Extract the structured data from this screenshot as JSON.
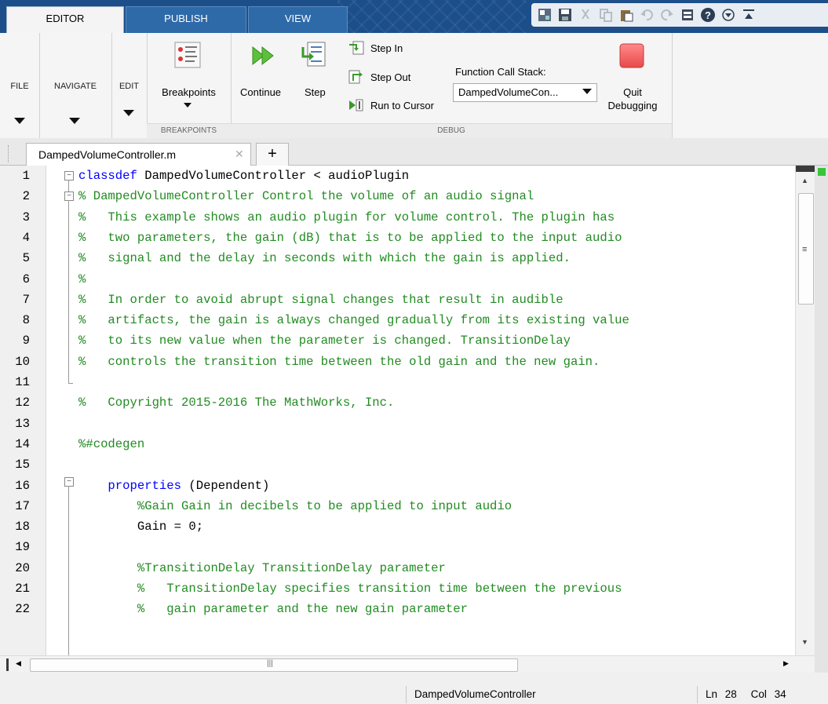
{
  "tabs": [
    {
      "label": "EDITOR",
      "active": true
    },
    {
      "label": "PUBLISH",
      "active": false
    },
    {
      "label": "VIEW",
      "active": false
    }
  ],
  "quick_access": [
    "layout-icon",
    "save-icon",
    "cut-icon",
    "copy-icon",
    "paste-icon",
    "undo-icon",
    "redo-icon",
    "switch-windows-icon",
    "help-icon",
    "expand-icon",
    "minimize-ribbon-icon"
  ],
  "ribbon": {
    "file": {
      "label": "FILE"
    },
    "navigate": {
      "label": "NAVIGATE"
    },
    "edit": {
      "label": "EDIT"
    },
    "breakpoints": {
      "button": "Breakpoints",
      "section": "BREAKPOINTS"
    },
    "debug": {
      "continue": "Continue",
      "step": "Step",
      "step_in": "Step In",
      "step_out": "Step Out",
      "run_to_cursor": "Run to Cursor",
      "stack_label": "Function Call Stack:",
      "stack_value": "DampedVolumeCon...",
      "quit_line1": "Quit",
      "quit_line2": "Debugging",
      "section": "DEBUG"
    }
  },
  "document": {
    "tab_name": "DampedVolumeController.m",
    "new_tab": "+"
  },
  "code_lines": [
    {
      "n": "1",
      "kw": "classdef",
      "text": " DampedVolumeController < audioPlugin",
      "cm": ""
    },
    {
      "n": "2",
      "kw": "",
      "text": "",
      "cm": "% DampedVolumeController Control the volume of an audio signal"
    },
    {
      "n": "3",
      "kw": "",
      "text": "",
      "cm": "%   This example shows an audio plugin for volume control. The plugin has"
    },
    {
      "n": "4",
      "kw": "",
      "text": "",
      "cm": "%   two parameters, the gain (dB) that is to be applied to the input audio"
    },
    {
      "n": "5",
      "kw": "",
      "text": "",
      "cm": "%   signal and the delay in seconds with which the gain is applied."
    },
    {
      "n": "6",
      "kw": "",
      "text": "",
      "cm": "%"
    },
    {
      "n": "7",
      "kw": "",
      "text": "",
      "cm": "%   In order to avoid abrupt signal changes that result in audible"
    },
    {
      "n": "8",
      "kw": "",
      "text": "",
      "cm": "%   artifacts, the gain is always changed gradually from its existing value"
    },
    {
      "n": "9",
      "kw": "",
      "text": "",
      "cm": "%   to its new value when the parameter is changed. TransitionDelay"
    },
    {
      "n": "10",
      "kw": "",
      "text": "",
      "cm": "%   controls the transition time between the old gain and the new gain."
    },
    {
      "n": "11",
      "kw": "",
      "text": "",
      "cm": ""
    },
    {
      "n": "12",
      "kw": "",
      "text": "",
      "cm": "%   Copyright 2015-2016 The MathWorks, Inc."
    },
    {
      "n": "13",
      "kw": "",
      "text": "",
      "cm": ""
    },
    {
      "n": "14",
      "kw": "",
      "text": "",
      "cm": "%#codegen"
    },
    {
      "n": "15",
      "kw": "",
      "text": "",
      "cm": ""
    },
    {
      "n": "16",
      "kw": "    properties",
      "text": " (Dependent)",
      "cm": ""
    },
    {
      "n": "17",
      "kw": "",
      "text": "        ",
      "cm": "%Gain Gain in decibels to be applied to input audio"
    },
    {
      "n": "18",
      "kw": "",
      "text": "        Gain = 0;",
      "cm": ""
    },
    {
      "n": "19",
      "kw": "",
      "text": "",
      "cm": ""
    },
    {
      "n": "20",
      "kw": "",
      "text": "        ",
      "cm": "%TransitionDelay TransitionDelay parameter"
    },
    {
      "n": "21",
      "kw": "",
      "text": "        ",
      "cm": "%   TransitionDelay specifies transition time between the previous"
    },
    {
      "n": "22",
      "kw": "",
      "text": "        ",
      "cm": "%   gain parameter and the new gain parameter"
    }
  ],
  "status": {
    "function_name": "DampedVolumeController",
    "ln_label": "Ln",
    "ln_value": "28",
    "col_label": "Col",
    "col_value": "34"
  },
  "colors": {
    "keyword": "#0000ff",
    "comment": "#228b22",
    "tabstrip": "#1c4f8a"
  }
}
